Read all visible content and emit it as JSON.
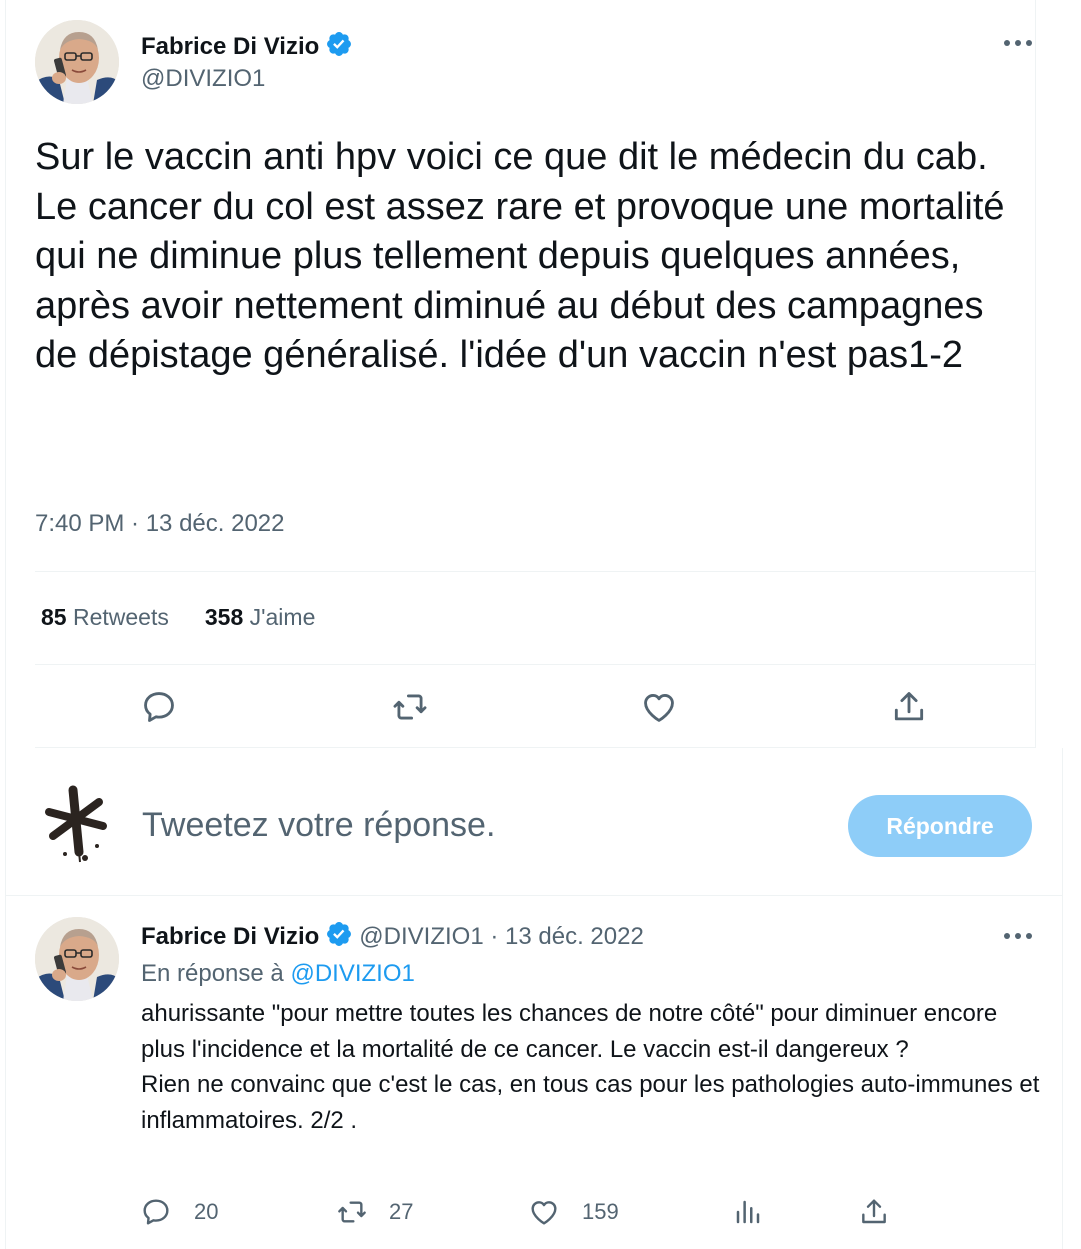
{
  "main_tweet": {
    "author": {
      "name": "Fabrice Di Vizio",
      "handle": "@DIVIZIO1",
      "verified": true
    },
    "text": "Sur le vaccin anti hpv voici ce que dit le médecin du cab.\nLe cancer du col est assez rare et provoque une mortalité qui ne diminue plus tellement depuis quelques années, après avoir nettement diminué au début des campagnes de dépistage généralisé. l'idée d'un vaccin n'est pas1-2",
    "timestamp": "7:40 PM · 13 déc. 2022",
    "stats": {
      "retweets_count": "85",
      "retweets_label": "Retweets",
      "likes_count": "358",
      "likes_label": "J'aime"
    },
    "actions": [
      "reply-icon",
      "retweet-icon",
      "like-icon",
      "share-icon"
    ]
  },
  "reply_composer": {
    "placeholder": "Tweetez votre réponse.",
    "button_label": "Répondre"
  },
  "reply_tweet": {
    "author": {
      "name": "Fabrice Di Vizio",
      "handle": "@DIVIZIO1",
      "verified": true
    },
    "date": "· 13 déc. 2022",
    "in_reply_prefix": "En réponse à",
    "in_reply_handle": "@DIVIZIO1",
    "text": "ahurissante \"pour mettre toutes les chances de notre côté\" pour diminuer encore plus l'incidence et la mortalité de ce cancer. Le vaccin est-il dangereux ?\nRien ne convainc que c'est le cas, en tous cas pour les pathologies auto-immunes et inflammatoires. 2/2 .",
    "replies": "20",
    "retweets": "27",
    "likes": "159"
  },
  "colors": {
    "text": "#0f1419",
    "secondary": "#536471",
    "accent": "#1d9bf0",
    "button_disabled": "#8ecdf8",
    "divider": "#eff3f4"
  }
}
